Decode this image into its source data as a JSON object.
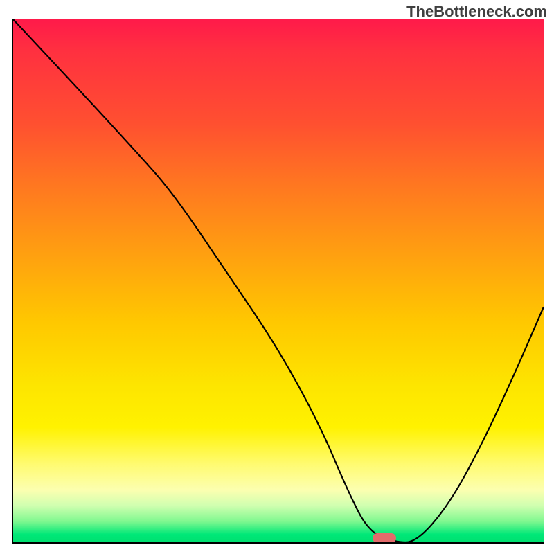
{
  "watermark": "TheBottleneck.com",
  "chart_data": {
    "type": "line",
    "title": "",
    "xlabel": "",
    "ylabel": "",
    "xlim": [
      0,
      100
    ],
    "ylim": [
      0,
      100
    ],
    "grid": false,
    "legend": false,
    "series": [
      {
        "name": "bottleneck-curve",
        "x": [
          0,
          12,
          22,
          30,
          40,
          50,
          58,
          63,
          67,
          72,
          76,
          82,
          88,
          94,
          100
        ],
        "values": [
          100,
          87,
          76,
          67,
          52,
          37,
          22,
          10,
          2,
          0,
          0,
          7,
          18,
          31,
          45
        ]
      }
    ],
    "marker": {
      "x": 70,
      "y": 0.8,
      "color": "#e36b6b"
    },
    "background_gradient": {
      "top": "#ff1a4a",
      "mid": "#fde500",
      "bottom": "#00e070"
    }
  }
}
